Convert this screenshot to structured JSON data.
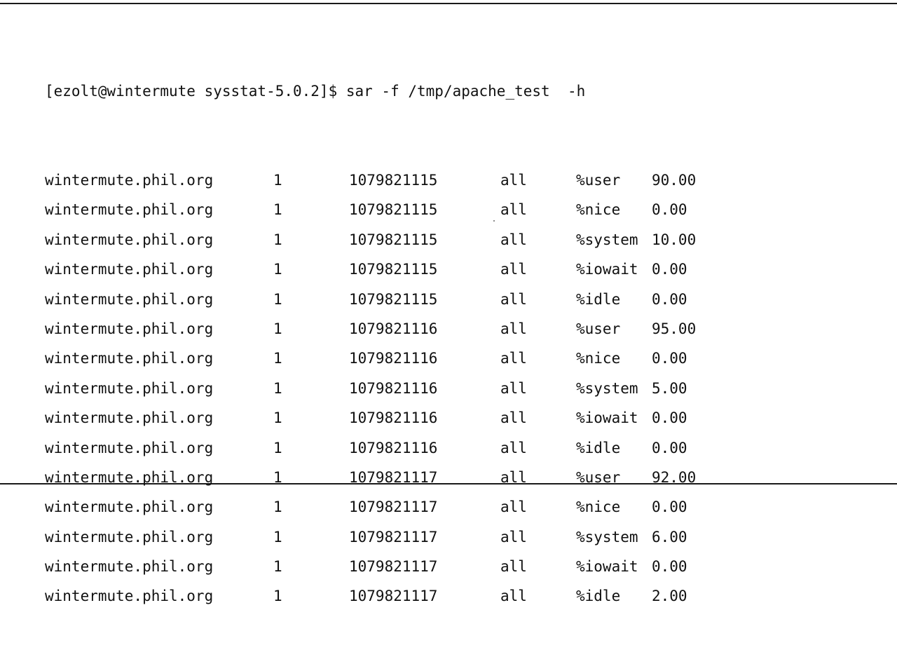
{
  "terminal": {
    "prompt": "[ezolt@wintermute sysstat-5.0.2]$ sar -f /tmp/apache_test  -h",
    "rows": [
      {
        "host": "wintermute.phil.org",
        "interval": "1",
        "timestamp": "1079821115",
        "cpu": "all",
        "metric": "%user",
        "value": "90.00"
      },
      {
        "host": "wintermute.phil.org",
        "interval": "1",
        "timestamp": "1079821115",
        "cpu": "all",
        "metric": "%nice",
        "value": "0.00"
      },
      {
        "host": "wintermute.phil.org",
        "interval": "1",
        "timestamp": "1079821115",
        "cpu": "all",
        "metric": "%system",
        "value": "10.00"
      },
      {
        "host": "wintermute.phil.org",
        "interval": "1",
        "timestamp": "1079821115",
        "cpu": "all",
        "metric": "%iowait",
        "value": "0.00"
      },
      {
        "host": "wintermute.phil.org",
        "interval": "1",
        "timestamp": "1079821115",
        "cpu": "all",
        "metric": "%idle",
        "value": "0.00"
      },
      {
        "host": "wintermute.phil.org",
        "interval": "1",
        "timestamp": "1079821116",
        "cpu": "all",
        "metric": "%user",
        "value": "95.00"
      },
      {
        "host": "wintermute.phil.org",
        "interval": "1",
        "timestamp": "1079821116",
        "cpu": "all",
        "metric": "%nice",
        "value": "0.00"
      },
      {
        "host": "wintermute.phil.org",
        "interval": "1",
        "timestamp": "1079821116",
        "cpu": "all",
        "metric": "%system",
        "value": "5.00"
      },
      {
        "host": "wintermute.phil.org",
        "interval": "1",
        "timestamp": "1079821116",
        "cpu": "all",
        "metric": "%iowait",
        "value": "0.00"
      },
      {
        "host": "wintermute.phil.org",
        "interval": "1",
        "timestamp": "1079821116",
        "cpu": "all",
        "metric": "%idle",
        "value": "0.00"
      },
      {
        "host": "wintermute.phil.org",
        "interval": "1",
        "timestamp": "1079821117",
        "cpu": "all",
        "metric": "%user",
        "value": "92.00"
      },
      {
        "host": "wintermute.phil.org",
        "interval": "1",
        "timestamp": "1079821117",
        "cpu": "all",
        "metric": "%nice",
        "value": "0.00"
      },
      {
        "host": "wintermute.phil.org",
        "interval": "1",
        "timestamp": "1079821117",
        "cpu": "all",
        "metric": "%system",
        "value": "6.00"
      },
      {
        "host": "wintermute.phil.org",
        "interval": "1",
        "timestamp": "1079821117",
        "cpu": "all",
        "metric": "%iowait",
        "value": "0.00"
      },
      {
        "host": "wintermute.phil.org",
        "interval": "1",
        "timestamp": "1079821117",
        "cpu": "all",
        "metric": "%idle",
        "value": "2.00"
      }
    ]
  },
  "colors": {
    "text": "#111111",
    "background": "#ffffff",
    "rule": "#1a1a1a"
  }
}
